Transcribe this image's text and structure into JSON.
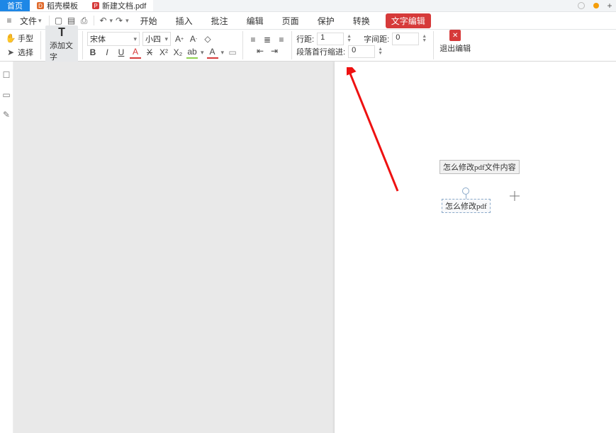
{
  "tabs": {
    "home": "首页",
    "doc1": "稻壳模板",
    "doc2": "新建文档.pdf",
    "add": "+"
  },
  "menubar": {
    "file": "文件",
    "items": [
      "开始",
      "插入",
      "批注",
      "编辑",
      "页面",
      "保护",
      "转换"
    ],
    "active": "文字编辑"
  },
  "toolbar": {
    "hand": "手型",
    "select": "选择",
    "add_text": "添加文字",
    "font_name": "宋体",
    "font_size": "小四",
    "bold": "B",
    "italic": "I",
    "underline": "U",
    "line_spacing_label": "行距:",
    "line_spacing_value": "1",
    "char_spacing_label": "字间距:",
    "char_spacing_value": "0",
    "first_indent_label": "段落首行缩进:",
    "first_indent_value": "0",
    "exit_edit": "退出编辑"
  },
  "document": {
    "text1": "怎么修改pdf文件内容",
    "text2": "怎么修改pdf"
  },
  "colors": {
    "accent_blue": "#1e87e6",
    "accent_red": "#d63a3a"
  }
}
